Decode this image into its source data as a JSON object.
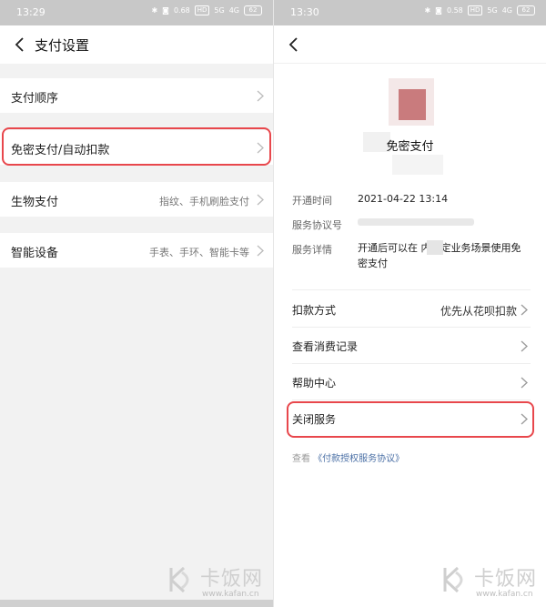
{
  "left": {
    "status": {
      "time": "13:29",
      "net": "0.68",
      "net_unit": "KB/s",
      "hd": "HD",
      "signal1": "5G",
      "signal2": "4G",
      "battery": "62"
    },
    "nav": {
      "title": "支付设置"
    },
    "items": [
      {
        "label": "支付顺序",
        "value": ""
      },
      {
        "label": "免密支付/自动扣款",
        "value": ""
      },
      {
        "label": "生物支付",
        "value": "指纹、手机刷脸支付"
      },
      {
        "label": "智能设备",
        "value": "手表、手环、智能卡等"
      }
    ],
    "highlight_color": "#e8474c"
  },
  "right": {
    "status": {
      "time": "13:30",
      "net": "0.58",
      "net_unit": "KB/s",
      "hd": "HD",
      "signal1": "5G",
      "signal2": "4G",
      "battery": "62"
    },
    "service_name": "免密支付",
    "info": {
      "open_time_label": "开通时间",
      "open_time_value": "2021-04-22 13:14",
      "agreement_no_label": "服务协议号",
      "detail_label": "服务详情",
      "detail_value": "开通后可以在   内指定业务场景使用免密支付"
    },
    "actions": [
      {
        "label": "扣款方式",
        "value": "优先从花呗扣款"
      },
      {
        "label": "查看消费记录",
        "value": ""
      },
      {
        "label": "帮助中心",
        "value": ""
      },
      {
        "label": "关闭服务",
        "value": ""
      }
    ],
    "agreement": {
      "prefix": "查看",
      "link": "《付款授权服务协议》"
    }
  },
  "watermark": {
    "title": "卡饭网",
    "url": "www.kafan.cn"
  }
}
